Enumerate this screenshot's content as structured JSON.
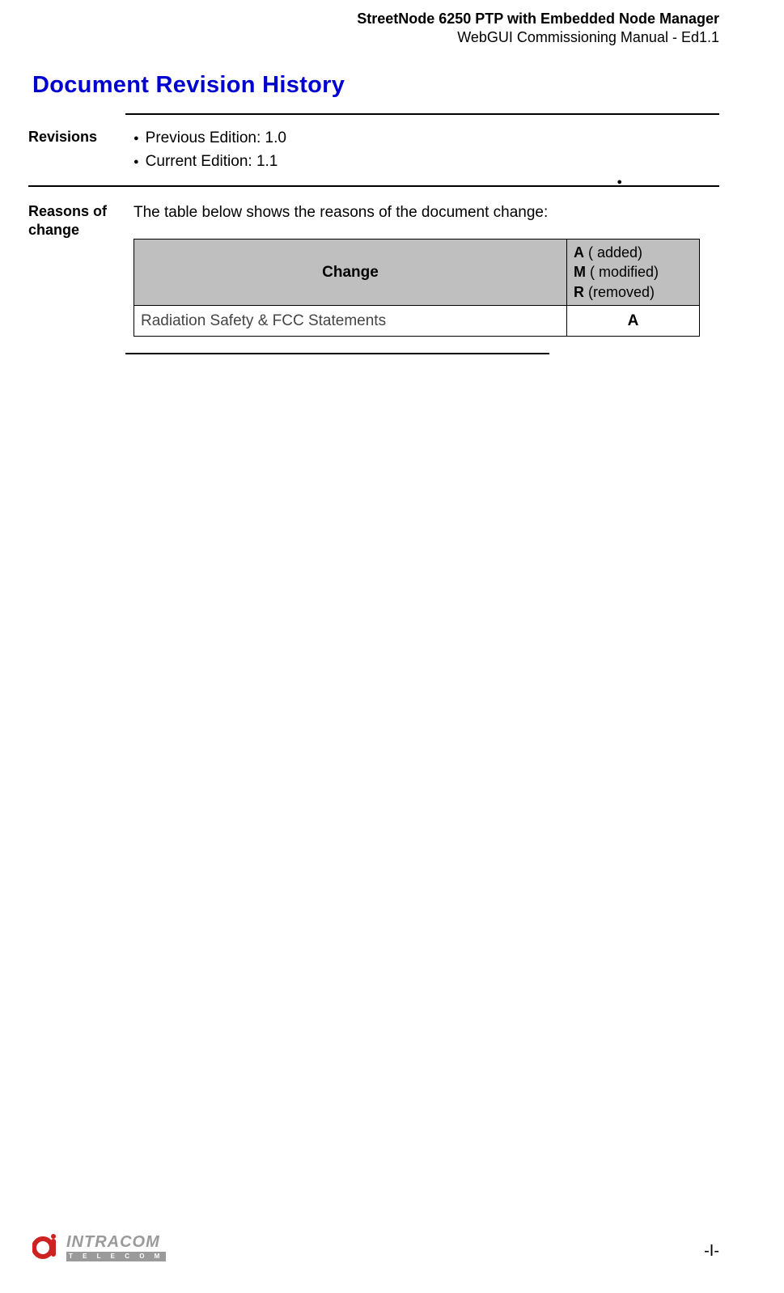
{
  "header": {
    "title": "StreetNode 6250 PTP with Embedded Node Manager",
    "subtitle": "WebGUI Commissioning Manual - Ed1.1"
  },
  "section_title": "Document Revision History",
  "revisions": {
    "label": "Revisions",
    "items": [
      "Previous Edition: 1.0",
      "Current Edition: 1.1"
    ]
  },
  "reasons": {
    "label": "Reasons of change",
    "intro": "The table below shows the reasons of the document change:",
    "table": {
      "header_change": "Change",
      "legend_a_key": "A",
      "legend_a_val": " ( added)",
      "legend_m_key": "M",
      "legend_m_val": " ( modified)",
      "legend_r_key": "R",
      "legend_r_val": " (removed)",
      "rows": [
        {
          "change": "Radiation Safety & FCC Statements",
          "code": "A"
        }
      ]
    }
  },
  "footer": {
    "logo_main": "INTRACOM",
    "logo_sub": "T E L E C O M",
    "page": "-I-"
  }
}
